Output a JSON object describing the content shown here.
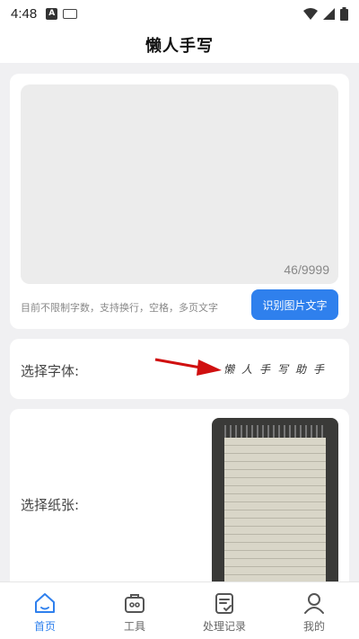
{
  "status_bar": {
    "time": "4:48"
  },
  "header": {
    "title": "懒人手写"
  },
  "input_card": {
    "char_count": "46/9999",
    "hint": "目前不限制字数，支持换行，空格，多页文字",
    "recognize_button": "识别图片文字"
  },
  "font_card": {
    "label": "选择字体:",
    "sample_text": "懒人手写助手"
  },
  "paper_card": {
    "label": "选择纸张:"
  },
  "tabs": [
    {
      "label": "首页",
      "icon": "home-icon"
    },
    {
      "label": "工具",
      "icon": "toolbox-icon"
    },
    {
      "label": "处理记录",
      "icon": "clipboard-icon"
    },
    {
      "label": "我的",
      "icon": "user-icon"
    }
  ],
  "colors": {
    "accent": "#2f80ed",
    "background": "#f0f0f2",
    "arrow": "#d01010"
  }
}
